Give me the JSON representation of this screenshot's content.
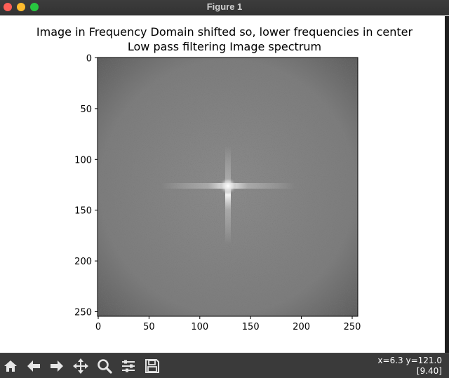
{
  "window": {
    "title": "Figure 1"
  },
  "figure": {
    "title_line1": "Image in Frequency Domain shifted so, lower frequencies in center",
    "title_line2": "Low pass filtering Image spectrum",
    "x_ticks": [
      "0",
      "50",
      "100",
      "150",
      "200",
      "250"
    ],
    "y_ticks": [
      "0",
      "50",
      "100",
      "150",
      "200",
      "250"
    ],
    "image_colors": {
      "background": "#7a7a7a",
      "center_peak": "#f2f2f2"
    }
  },
  "toolbar": {
    "buttons": [
      {
        "name": "home-icon"
      },
      {
        "name": "back-arrow-icon"
      },
      {
        "name": "forward-arrow-icon"
      },
      {
        "name": "pan-move-icon"
      },
      {
        "name": "zoom-magnifier-icon"
      },
      {
        "name": "configure-subplots-icon"
      },
      {
        "name": "save-floppy-icon"
      }
    ],
    "coords_line1": "x=6.3 y=121.0",
    "coords_line2": "[9.40]"
  }
}
